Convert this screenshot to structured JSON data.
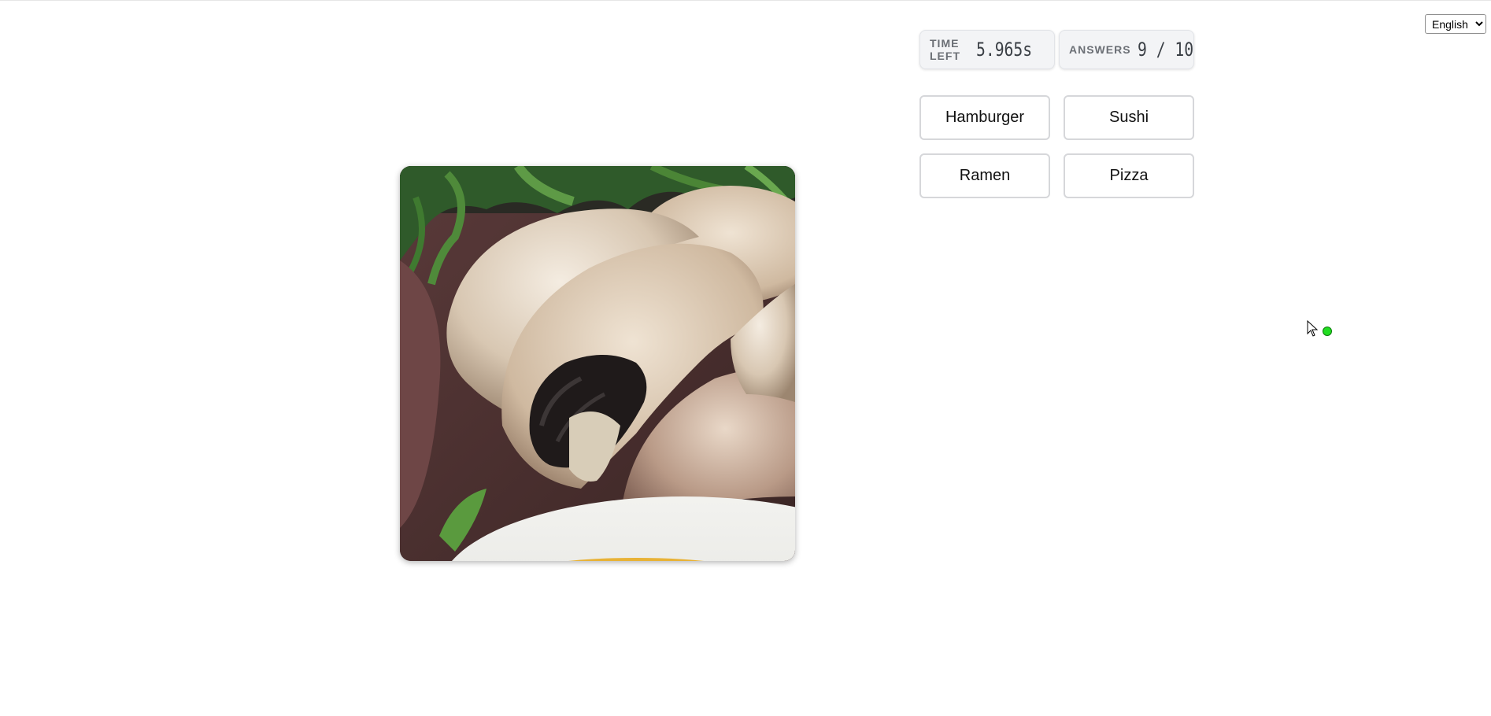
{
  "language": {
    "selected": "English"
  },
  "stats": {
    "time_label": "TIME LEFT",
    "time_value": "5.965s",
    "answers_label": "ANSWERS",
    "answers_value": "9 / 10"
  },
  "answers": {
    "options": [
      "Hamburger",
      "Sushi",
      "Ramen",
      "Pizza"
    ]
  },
  "colors": {
    "status_dot": "#22dd22",
    "panel_bg": "#f3f4f6"
  }
}
